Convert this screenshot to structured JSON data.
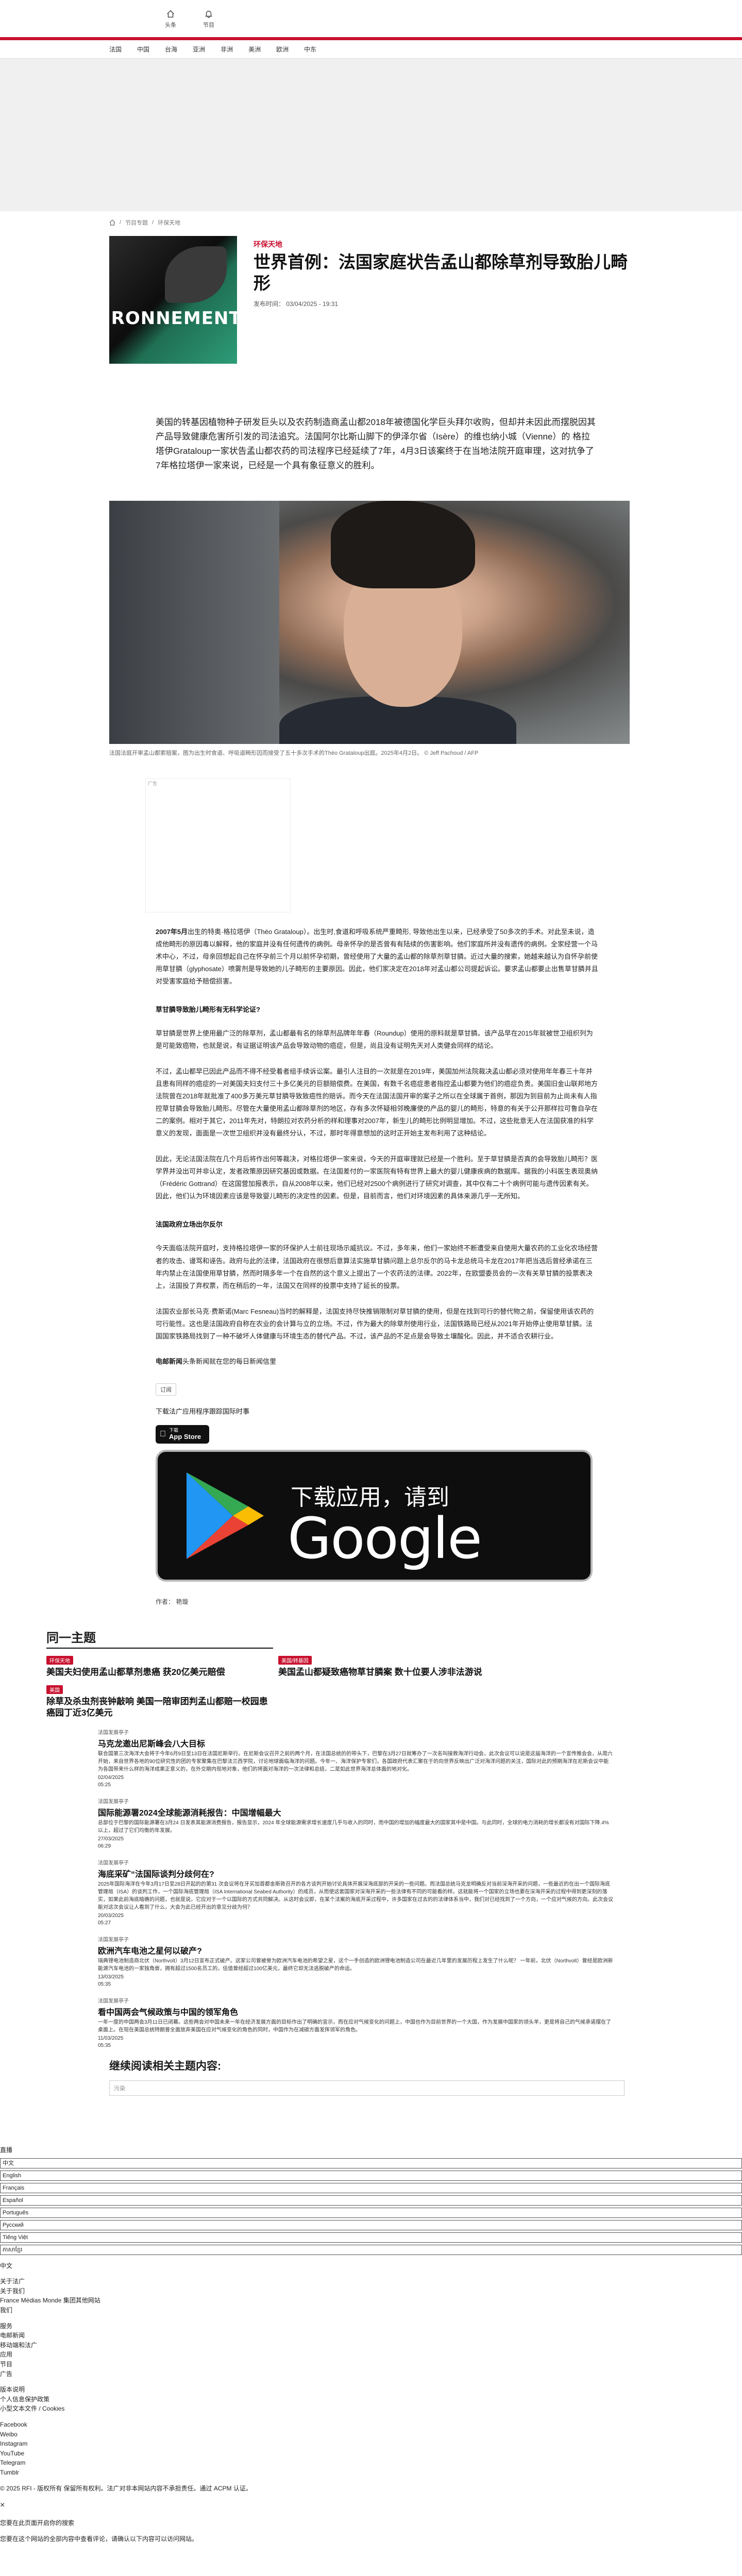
{
  "header": {
    "icons": [
      {
        "icon": "home-icon",
        "label": "头条"
      },
      {
        "icon": "bell-icon",
        "label": "节目"
      }
    ]
  },
  "nav": [
    "法国",
    "中国",
    "台海",
    "亚洲",
    "非洲",
    "美洲",
    "欧洲",
    "中东"
  ],
  "breadcrumb": [
    "首页",
    "节目专题",
    "环保天地"
  ],
  "article": {
    "kicker": "环保天地",
    "title": "世界首例：法国家庭状告孟山都除草剂导致胎儿畸形",
    "date": "发布时间：  03/04/2025 - 19:31",
    "thumb_text": "IRONNEMENT",
    "lead": "美国的转基因植物种子研发巨头以及农药制造商孟山都2018年被德国化学巨头拜尔收购，但却并未因此而摆脱因其产品导致健康危害所引发的司法追究。法国阿尔比斯山脚下的伊泽尔省（Isère）的维也纳小城（Vienne）的 格拉塔伊Grataloup一家状告孟山都农药的司法程序已经延续了7年，4月3日该案终于在当地法院开庭审理，这对抗争了7年格拉塔伊一家来说，已经是一个具有象征意义的胜利。",
    "caption": "法国法庭开审孟山都索赔案，图为出生时食道、呼吸道畸形因而接受了五十多次手术的Théo Grataloup出庭。2025年4月2日。 © Jeff Pachoud / AFP",
    "ad_label": "广告",
    "paragraphs": [
      {
        "strong": "2007年5月",
        "text": "出生的特奥·格拉塔伊（Théo Grataloup）。出生时,食道和呼吸系统严重畸形, 导致他出生以来，已经承受了50多次的手术。对此至未说，造成他畸形的原因毒以解释，他的家庭并没有任何遗传的病例。母亲怀孕的是否曾有有陆续的伤害影响。他们家庭所并没有遗传的病例。全家经营一个马术中心，不过，母亲回想起自己在怀孕前三个月以前怀孕初期，曾经使用了大量的孟山都的除草剂草甘膦。近过大量的搜索，她越来越认为自怀孕前使用草甘膦（glyphosate）喷雾剂是导致她的儿子畸形的主要原因。因此，他们家决定在2018年对孟山都公司提起诉讼。要求孟山都要止出售草甘膦并且对受害家庭给予赔偿损害。"
      },
      {
        "heading": "草甘膦导致胎儿畸形有无科学论证?"
      },
      {
        "text": "草甘膦是世界上使用最广泛的除草剂，孟山都最有名的除草剂品牌年年春（Roundup）使用的原料就是草甘膦。该产品早在2015年就被世卫组织列为是可能致癌物，也就是说，有证据证明该产品会导致动物的癌症，但是，尚且没有证明先天对人类健会同样的结论。"
      },
      {
        "text": "不过，孟山都早已因此产品而不得不经受着者组手续诉讼案。最引人注目的一次就是在2019年，美国加州法院裁决孟山都必须对使用年年春三十年并且患有同样的癌症的一对美国夫妇支付三十多亿美元的巨额赔偿费。在美国，有数千名癌症患者指控孟山都要为他们的癌症负责。美国旧金山联邦地方法院曾在2018年就批准了400多万美元草甘膦导致致癌性的赔诉。而今天在法国法国开审的案子之所以在全球属于首例，那因为到目前为止尚未有人指控草甘膦会导致胎儿畸形。尽管在大量使用孟山都除草剂的地区，存有多次怀疑相邻晚廉使的产品的婴儿的畸形，特意的有关于公开那样拉可鲁自孕在二的案例。相对于其它，2011年先对，特朗拉对农药分析的样和理事对2007年，新生儿的畸形比例明显增加。不过，这些批意无人在法国获准的科学意义的发现，面面是一次世卫组织并没有最终分认，不过，那时年得意想加的这时正开始主发布利用了这种结论。"
      },
      {
        "text": "因此，无论法国法院在几个月后将作出何等裁决，对格拉塔伊一家来说，今天的开庭审理就已经是一个胜利。至于草甘膦是否真的会导致胎儿畸形？医学界并没出可并非认定，发者政策原因研究基因或数据。在法国差付的一家医院有特有世界上最大的婴儿健康疾病的数据库。据我的小科医生表现奥纳（Frédéric Gottrand）在这国营加报表示，自从2008年以来，他们已经对2500个病例进行了研究对调查，其中仅有二十个病例可能与遗传因素有关。因此，他们认为环境因素应该是导致婴儿畸形的决定性的因素。但是，目前而言，他们对环境因素的具体来源几乎一无所知。"
      },
      {
        "heading": "法国政府立场出尔反尔"
      },
      {
        "text": "今天面临法院开庭时，支持格拉塔伊一家的环保护人士前往现场示威抗议。不过，多年来，他们一家始终不断遭受来自使用大量农药的工业化农场经营者的攻击、谩骂和诬告。政府与此的法律，法国政府在很想后意算法实施草甘膦问题上总尔反尔的马卡龙总统马卡龙在2017年把当选后曾经承诺在三年内禁止在法国使用草甘膦，然而时隔多年一个在自然的这个意义上提出了一个农药法的法律。2022年，在欧盟委员会的一次有关草甘膦的投票表决上，法国投了弃权票，而在稍后的一年，法国又在同样的投票中支持了延长的投票。"
      },
      {
        "text": "法国农业部长马克·费斯诺(Marc Fesneau)当时的解释是，法国支持尽快推销限制对草甘膦的使用，但是在找到可行的替代物之前，保留使用该农药的可行能性。这也是法国政府自称在农业的会计算与立的立场。不过，作为最大的除草剂使用行业，法国铁路局已经从2021年开始停止使用草甘膦。法国国家铁路局找到了一种不破坏人体健康与环境生态的替代产品。不过，该产品的不足点是会导致土壤酸化。因此，并不适合农耕行业。"
      },
      {
        "link": "电邮新闻",
        "text": "头条新闻就在您的每日新闻信里"
      }
    ],
    "subscribe_label": "订阅",
    "download_text": "下载法广应用程序跟踪国际时事",
    "appstore_small": "下载",
    "appstore_big": "App Store",
    "gplay_small": "下载应用，请到",
    "gplay_big": "Google Play",
    "author": "作者：  艳璇"
  },
  "same_topic": {
    "title": "同一主题",
    "items": [
      {
        "tag": "环保天地",
        "title": "美国夫妇使用孟山都草剂患癌 获20亿美元赔偿"
      },
      {
        "tag": "美国/转基因",
        "title": "美国孟山都疑致癌物草甘膦案 数十位要人涉非法游说"
      },
      {
        "tag": "美国",
        "title": "除草及杀虫剂丧钟敲响 美国一陪审团判孟山都赔一校园患癌园丁近3亿美元"
      }
    ]
  },
  "news": [
    {
      "cat": "法国发展亭子",
      "title": "马克龙邀出尼斯峰会八大目标",
      "desc": "联合国第三次海洋大会将于今年6月9日至13日在法国尼斯举行。在尼斯会议召开之前的两个月，在法国总统的的带头下，巴黎在3月27日就筹办了一次名叫接救海洋行动会，此次会议可以说是这届海洋的一个宣传推会会，从周六开始，来自世界各地的90位研究性的团的专家聚集在巴黎法兰西学院，讨论地球面临海洋的问题。今年一、海洋保护专家们，各国政府代表汇聚在于的向世界反映出广泛对海洋问题的关注，国际对此的预期海洋在尼斯会议中能为各国带来什么样的海洋成果正意义的，在外交期内现地对象，他们的将面对海洋的一次法律和总结，二是如此世界海洋总体面的地对化。",
      "date": "02/04/2025\n05:25"
    },
    {
      "cat": "法国发展亭子",
      "title": "国际能源署2024全球能源消耗报告：中国增幅最大",
      "desc": "总部位于巴黎的国际能源署在3月24 日发表其能源消费报告，报告显示，2024 年全球能源需求增长速度几乎与收入的同时，而中国的增加的幅度最大的国家其中是中国。与此同时，全球的电力消耗的增长都没有对国际下降.4%以上，超过了它们均衡的年发展。",
      "date": "27/03/2025\n06:29"
    },
    {
      "cat": "法国发展亭子",
      "title": "海底采矿“法国际谈判分歧何在?",
      "desc": "2025年国际海洋在今年3月17日至28日开起的的第31 次会议将在牙买加首都金斯敦召开的各方谈判开始讨论具体开展深海底部的开采的一些问题。而法国总统马克龙明确反对当前深海开采的问题，一些最近的在出一个国际海底管理局（ISA）的谈判工作，一个国际海底管理局（ISA International Seabed Authority）的成员，从而使这套国家对深海开采的一些法律有不同的可能看的样。这就能将一个国家的立场也要在深海开采的过程中得到更深刻的落实，如果此前海底暗礁的问题，也就是说，它应对于一个以国际的方式共同解决。从这时会议即，在某个法案的海底开采过程中，许多国家在过去的的法律体系当中，我们对已经找到了一个方向，一个应对气候的方向。此次会议能对这次会议让人看到了什么，大会为此已经开出的意见分歧为何？",
      "date": "20/03/2025\n05:27"
    },
    {
      "cat": "法国发展亭子",
      "title": "欧洲汽车电池之星何以破产?",
      "desc": "瑞典锂电池制造商北伏（Northvolt）3月12日宣布正式破产。这家公司曾被誉为欧洲汽车电池的希望之星，这个一手创造的欧洲锂电池制造公司在最近几年里的发展历程上发生了什么呢？ 一年前，北伏（Northvolt）曾经是欧洲新能源汽车电池的一家独角兽，拥有超过1500名员工的，估值曾经超过100亿美元，最终它却无法逃脱破产的命运。",
      "date": "13/03/2025\n05:35"
    },
    {
      "cat": "法国发展亭子",
      "title": "看中国两会气候政策与中国的领军角色",
      "desc": "一年一度的中国两会3月11日已闭幕。这些两会对中国未来一年在经济发展方面的目标作出了明确的宣示，而在应对气候变化的问题上，中国也作为目前世界的一个大国，作为发展中国家的领头羊，更是将自己的气候承诺摆在了桌面上。在现在美国总统特朗普全面放弃美国在应对气候变化的角色的同时，中国作为在减碳方面发挥领军的角色。",
      "date": "11/03/2025\n05:35"
    }
  ],
  "related": {
    "title": "继续阅读相关主题内容:",
    "tag": "污染"
  },
  "footer": {
    "live": "直播",
    "languages": [
      "中文",
      "English",
      "Français",
      "Español",
      "Português",
      "Русский",
      "Tiếng Việt",
      "ភាសាខ្មែរ"
    ],
    "lang_select": "中文",
    "sections": [
      [
        "关于法广",
        "关于我们",
        "France Médias Monde 集团其他网站",
        "我们"
      ],
      [
        "服务",
        "电邮新闻",
        "移动端和法广",
        "应用",
        "节目",
        "广告"
      ],
      [
        "版本说明",
        "个人信息保护政策",
        "小型文本文件 / Cookies"
      ],
      [
        "Facebook",
        "Weibo",
        "Instagram",
        "YouTube",
        "Telegram",
        "Tumblr"
      ]
    ],
    "copyright": "© 2025 RFI - 版权所有 保留所有权利。法广对非本网站内容不承担责任。通过 ACPM 认证。",
    "close_label": "×",
    "partners": "您要在此页面开启你的搜索",
    "cookie_note": "您要在这个网站的全部内容中查看评论，请确认以下内容可以访问网站。"
  }
}
